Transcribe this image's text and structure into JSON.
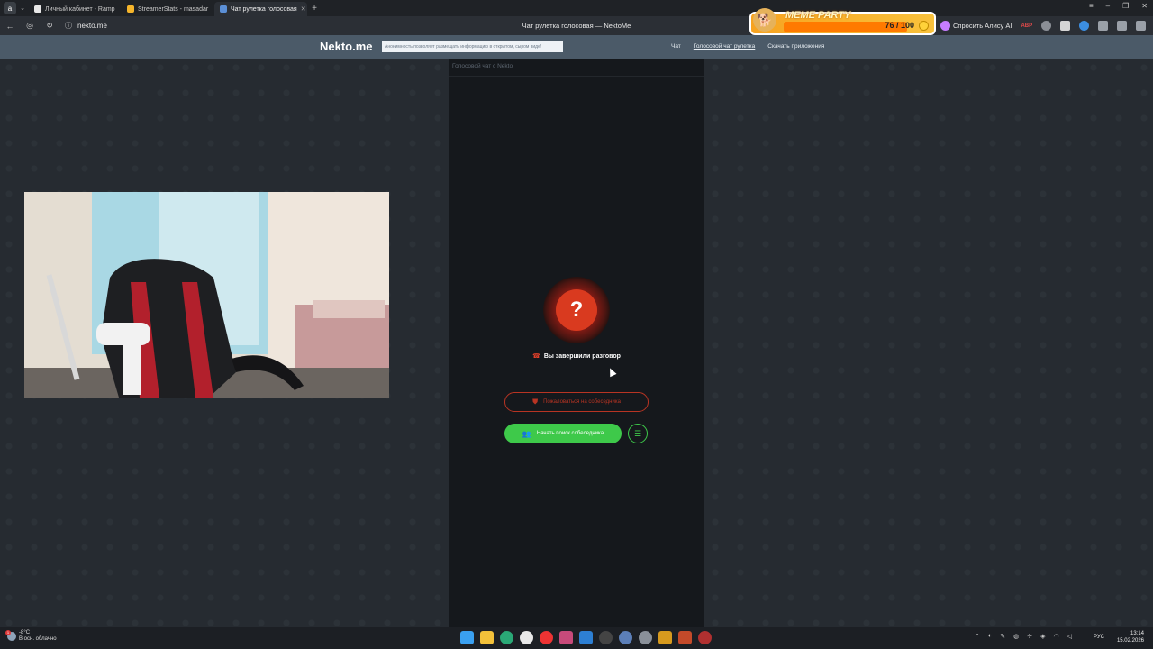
{
  "browser": {
    "tabs": [
      {
        "label": "Личный кабинет - Ramp",
        "color": "#e8e8e8",
        "active": false
      },
      {
        "label": "StreamerStats - masadar",
        "color": "#f5b52b",
        "active": false
      },
      {
        "label": "Чат рулетка голосовая",
        "color": "#5b8fd6",
        "active": true
      }
    ],
    "tab_close_glyph": "✕",
    "new_tab_glyph": "+",
    "url": "nekto.me",
    "page_title": "Чат рулетка голосовая — NektoMe",
    "alice_label": "Спросить Алису AI",
    "abp_label": "ABP",
    "meme": {
      "title": "MEME PARTY",
      "count": "76 / 100"
    }
  },
  "site": {
    "logo": "Nekto.me",
    "notice": "Анонимность позволяет размещать информацию в открытом, сыром виде!",
    "nav": [
      {
        "label": "Чат",
        "underline": false
      },
      {
        "label": "Голосовой чат рулетка",
        "underline": true
      },
      {
        "label": "Скачать приложения",
        "underline": false
      }
    ]
  },
  "panel": {
    "header": "Голосовой чат с Nekto",
    "question_glyph": "?",
    "ended_text": "Вы завершили разговор",
    "complain_label": "Пожаловаться на собеседника",
    "start_label": "Начать поиск собеседника"
  },
  "taskbar": {
    "temperature": "-8°C",
    "weather": "В осн. облачно",
    "weather_badge": "1",
    "lang": "РУС",
    "time": "13:14",
    "date": "15.02.2026"
  },
  "colors": {
    "accent_green": "#3ec94a",
    "accent_red": "#d93a1f",
    "header_bg": "#4b5a68"
  }
}
